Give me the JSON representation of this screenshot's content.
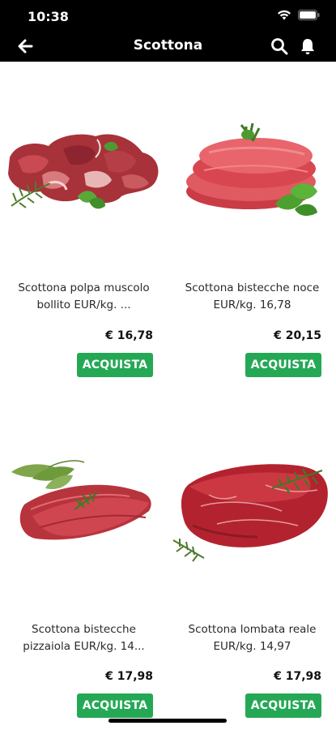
{
  "status_bar": {
    "time": "10:38"
  },
  "header": {
    "title": "Scottona"
  },
  "products": [
    {
      "name": "Scottona  polpa muscolo bollito EUR/kg. ...",
      "price": "€ 16,78",
      "buy_label": "ACQUISTA",
      "image": "beef-chunks-image"
    },
    {
      "name": "Scottona bistecche noce EUR/kg. 16,78",
      "price": "€ 20,15",
      "buy_label": "ACQUISTA",
      "image": "beef-slices-image"
    },
    {
      "name": "Scottona bistecche pizzaiola  EUR/kg. 14...",
      "price": "€ 17,98",
      "buy_label": "ACQUISTA",
      "image": "thin-steaks-image"
    },
    {
      "name": "Scottona lombata reale EUR/kg. 14,97",
      "price": "€ 17,98",
      "buy_label": "ACQUISTA",
      "image": "sirloin-steak-image"
    }
  ],
  "colors": {
    "bar_background": "#000000",
    "accent_green": "#25a855"
  },
  "icons": [
    "back-arrow-icon",
    "search-icon",
    "bell-icon",
    "wifi-icon",
    "battery-icon"
  ]
}
